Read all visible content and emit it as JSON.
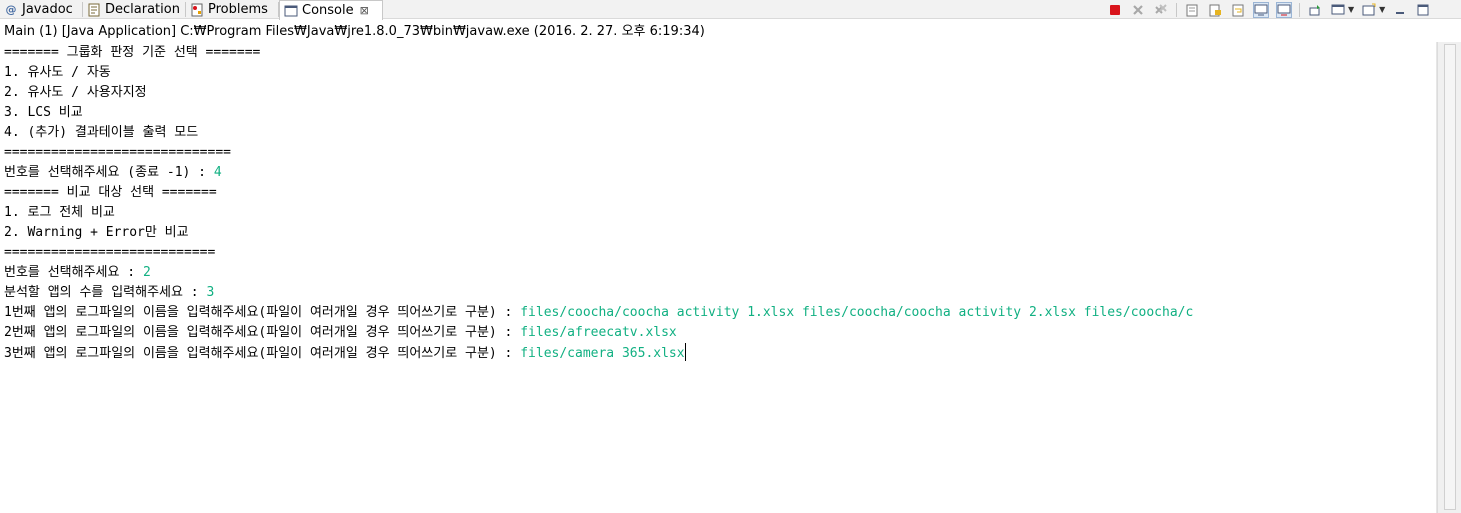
{
  "tabs": [
    {
      "label": "Javadoc",
      "icon": "at-icon"
    },
    {
      "label": "Declaration",
      "icon": "declaration-icon"
    },
    {
      "label": "Problems",
      "icon": "problems-icon"
    },
    {
      "label": "Console",
      "icon": "console-icon",
      "active": true,
      "close": "⊠"
    }
  ],
  "launch_info": "Main (1) [Java Application] C:₩Program Files₩Java₩jre1.8.0_73₩bin₩javaw.exe (2016. 2. 27. 오후 6:19:34)",
  "console_lines": [
    {
      "out": "======= 그룹화 판정 기준 선택 =======",
      "in": ""
    },
    {
      "out": "1. 유사도 / 자동",
      "in": ""
    },
    {
      "out": "2. 유사도 / 사용자지정",
      "in": ""
    },
    {
      "out": "3. LCS 비교",
      "in": ""
    },
    {
      "out": "4. (추가) 결과테이블 출력 모드",
      "in": ""
    },
    {
      "out": "=============================",
      "in": ""
    },
    {
      "out": "번호를 선택해주세요 (종료 -1) : ",
      "in": "4"
    },
    {
      "out": "======= 비교 대상 선택 =======",
      "in": ""
    },
    {
      "out": "1. 로그 전체 비교",
      "in": ""
    },
    {
      "out": "2. Warning + Error만 비교",
      "in": ""
    },
    {
      "out": "===========================",
      "in": ""
    },
    {
      "out": "번호를 선택해주세요 : ",
      "in": "2"
    },
    {
      "out": "분석할 앱의 수를 입력해주세요 : ",
      "in": "3"
    },
    {
      "out": "1번째 앱의 로그파일의 이름을 입력해주세요(파일이 여러개일 경우 띄어쓰기로 구분) : ",
      "in": "files/coocha/coocha activity 1.xlsx files/coocha/coocha activity 2.xlsx files/coocha/c"
    },
    {
      "out": "2번째 앱의 로그파일의 이름을 입력해주세요(파일이 여러개일 경우 띄어쓰기로 구분) : ",
      "in": "files/afreecatv.xlsx"
    },
    {
      "out": "3번째 앱의 로그파일의 이름을 입력해주세요(파일이 여러개일 경우 띄어쓰기로 구분) : ",
      "in": "files/camera 365.xlsx"
    }
  ],
  "toolbar_icons": [
    "terminate-icon",
    "remove-launch-icon",
    "remove-all-terminated-icon",
    "clear-console-icon",
    "scroll-lock-icon",
    "word-wrap-icon",
    "show-on-stdout-icon",
    "show-on-stderr-icon",
    "pin-console-icon",
    "display-selected-console-icon",
    "open-console-icon",
    "minimize-icon",
    "maximize-icon"
  ],
  "colors": {
    "input_text": "#11b082",
    "terminate": "#d9141c"
  }
}
